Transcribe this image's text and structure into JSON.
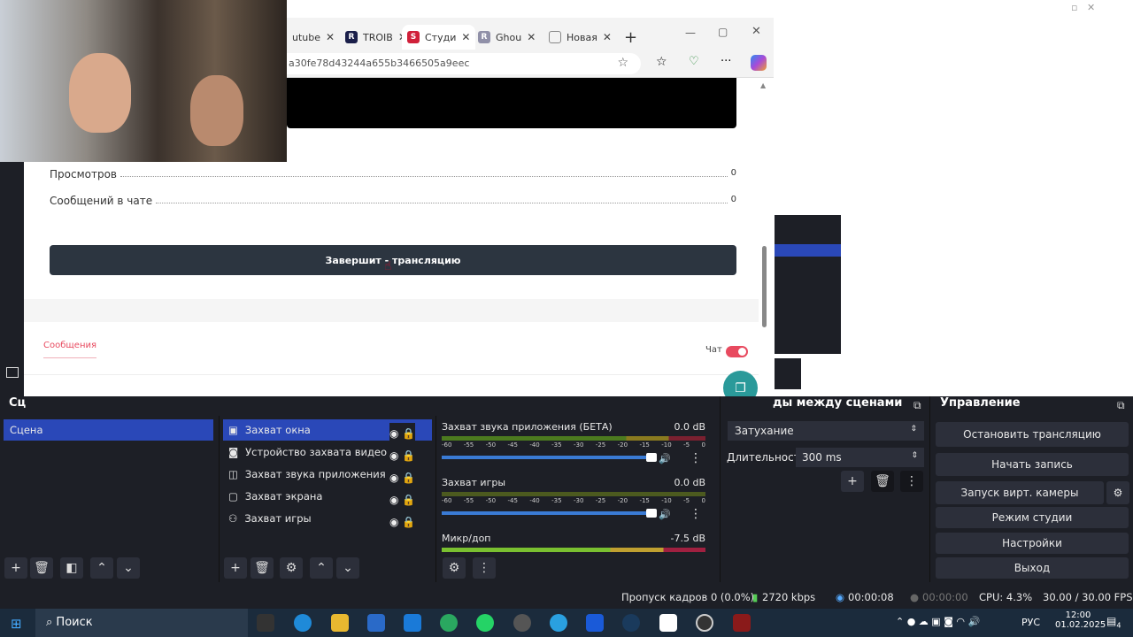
{
  "browser": {
    "tabs": [
      {
        "label": "utube"
      },
      {
        "label": "TROIB",
        "icon": "R"
      },
      {
        "label": "Студи",
        "icon": "S"
      },
      {
        "label": "Ghou",
        "icon": "R"
      },
      {
        "label": "Новая"
      }
    ],
    "url": "a30fe78d43244a655b3466505a9eec"
  },
  "page": {
    "stats": [
      {
        "label": "Просмотров",
        "value": "0"
      },
      {
        "label": "Сообщений в чате",
        "value": "0"
      }
    ],
    "end_button": "Завершит - трансляцию",
    "messages_tab": "Сообщения",
    "chat_label": "Чат"
  },
  "obs": {
    "scenes_header": "Сц",
    "scenes": [
      "Сцена"
    ],
    "sources": [
      {
        "label": "Захват окна"
      },
      {
        "label": "Устройство захвата видео"
      },
      {
        "label": "Захват звука приложения (БЕТ"
      },
      {
        "label": "Захват экрана"
      },
      {
        "label": "Захват игры"
      }
    ],
    "mixer": [
      {
        "name": "Захват звука приложения (БЕТА)",
        "db": "0.0 dB"
      },
      {
        "name": "Захват игры",
        "db": "0.0 dB"
      },
      {
        "name": "Микр/доп",
        "db": "-7.5 dB"
      }
    ],
    "ticks": [
      "-60",
      "-55",
      "-50",
      "-45",
      "-40",
      "-35",
      "-30",
      "-25",
      "-20",
      "-15",
      "-10",
      "-5",
      "0"
    ],
    "transitions": {
      "header": "ды между сценами",
      "type": "Затухание",
      "duration_label": "Длительность",
      "duration": "300 ms"
    },
    "controls": {
      "header": "Управление",
      "buttons": [
        "Остановить трансляцию",
        "Начать запись",
        "Запуск вирт. камеры",
        "Режим студии",
        "Настройки",
        "Выход"
      ]
    },
    "status": {
      "dropped": "Пропуск кадров 0 (0.0%)",
      "bitrate": "2720 kbps",
      "stream_time": "00:00:08",
      "rec_time": "00:00:00",
      "cpu": "CPU: 4.3%",
      "fps": "30.00 / 30.00 FPS"
    }
  },
  "taskbar": {
    "search": "Поиск",
    "lang": "РУС",
    "time": "12:00",
    "date": "01.02.2025",
    "notifications": "4"
  },
  "colors": {
    "accent": "#2a48b8",
    "end_button": "#2c3540",
    "toggle": "#e84a5f"
  }
}
